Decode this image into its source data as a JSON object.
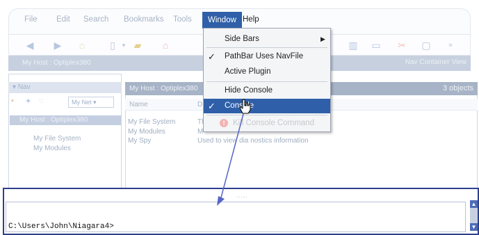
{
  "menubar": {
    "items": [
      {
        "label": "File"
      },
      {
        "label": "Edit"
      },
      {
        "label": "Search"
      },
      {
        "label": "Bookmarks"
      },
      {
        "label": "Tools"
      },
      {
        "label": "Window"
      },
      {
        "label": "Help"
      }
    ],
    "active": "Window"
  },
  "host_bar": {
    "title": "My Host : Optiplex380",
    "view_label": "Nav Container View"
  },
  "nav_pane": {
    "tab_label": "Nav",
    "network_dropdown": "My Net",
    "tree": {
      "root": "My Host : Optiplex380",
      "children": [
        "My File System",
        "My Modules"
      ]
    }
  },
  "table": {
    "title": "My Host : Optiplex380",
    "count": "3 objects",
    "columns": [
      "Name",
      "D"
    ],
    "rows": [
      {
        "name": "My File System",
        "desc": "Th"
      },
      {
        "name": "My Modules",
        "desc": "M"
      },
      {
        "name": "My Spy",
        "desc": "Used to view dia  nostics information"
      }
    ]
  },
  "window_menu": {
    "items": [
      {
        "label": "Side Bars",
        "submenu": true
      },
      {
        "label": "PathBar Uses NavFile",
        "checked": true
      },
      {
        "label": "Active Plugin"
      },
      {
        "label": "Hide Console"
      },
      {
        "label": "Console",
        "checked": true,
        "selected": true
      },
      {
        "label": "Kill Console Command",
        "disabled": true
      }
    ]
  },
  "console": {
    "prompt": "C:\\Users\\John\\Niagara4>",
    "resize_grip": "....."
  },
  "colors": {
    "accent": "#2f5fa8",
    "annotation": "#5565c8",
    "console_border": "#2d3f8e"
  },
  "icons": [
    "back-icon",
    "forward-icon",
    "home-icon",
    "refresh-icon",
    "folder-icon",
    "warning-icon",
    "checkmark-icon",
    "submenu-arrow-icon",
    "hand-cursor-icon"
  ]
}
